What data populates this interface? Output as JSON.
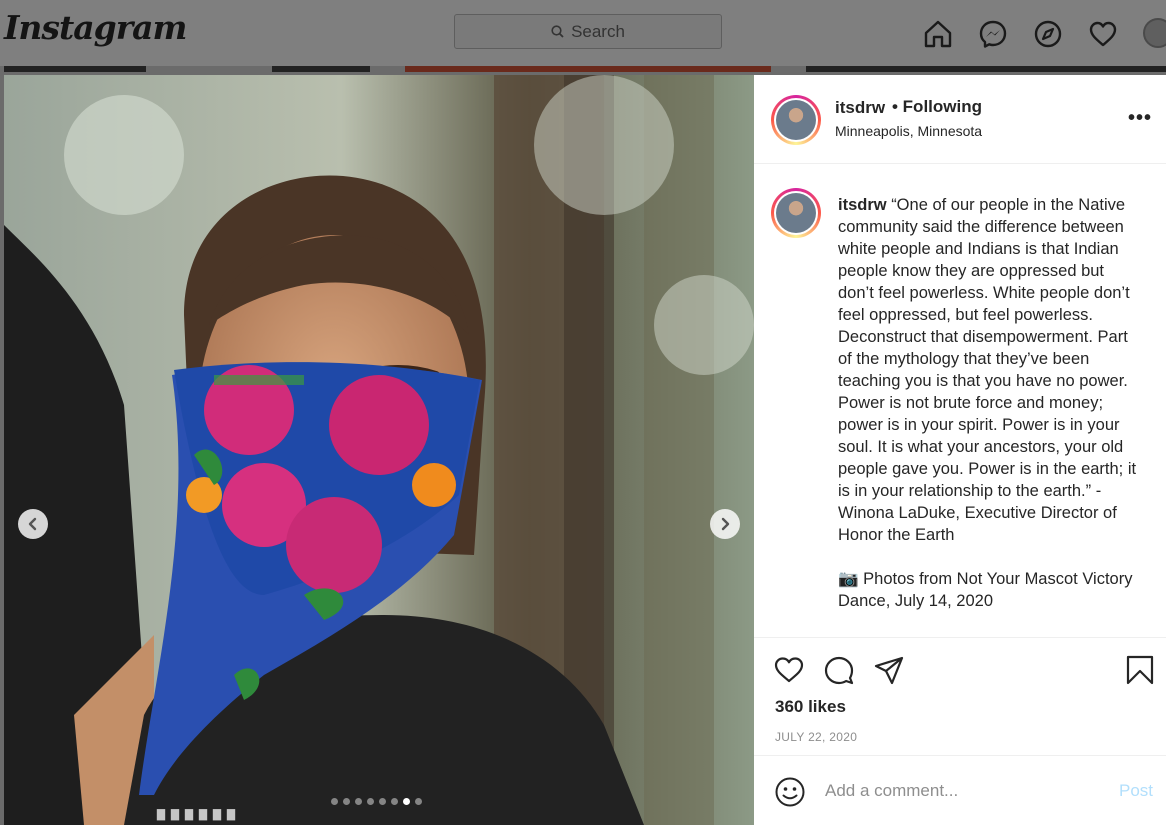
{
  "header": {
    "logo_text": "Instagram",
    "search_placeholder": "Search",
    "nav_icons": [
      "home-icon",
      "messenger-icon",
      "explore-icon",
      "activity-heart-icon",
      "profile-avatar"
    ]
  },
  "post": {
    "carousel": {
      "slide_count": 8,
      "active_index": 6
    },
    "author": {
      "username": "itsdrw",
      "follow_status": "• Following",
      "location": "Minneapolis, Minnesota"
    },
    "caption": {
      "username": "itsdrw",
      "text": "“One of our people in the Native community said the difference between white people and Indians is that Indian people know they are oppressed but don’t feel powerless. White people don’t feel oppressed, but feel powerless. Deconstruct that disempowerment. Part of the mythology that they’ve been teaching you is that you have no power. Power is not brute force and money; power is in your spirit. Power is in your soul. It is what your ancestors, your old people gave you. Power is in the earth; it is in your relationship to the earth.” - Winona LaDuke, Executive Director of Honor the Earth",
      "credit_icon": "📷",
      "credit_text": "Photos from Not Your Mascot Victory Dance, July 14, 2020"
    },
    "likes": "360 likes",
    "date": "JULY 22, 2020",
    "comment": {
      "placeholder": "Add a comment...",
      "post_label": "Post"
    }
  },
  "colors": {
    "post_button_disabled": "#b2dffc",
    "overlay": "#7f7f7f"
  }
}
